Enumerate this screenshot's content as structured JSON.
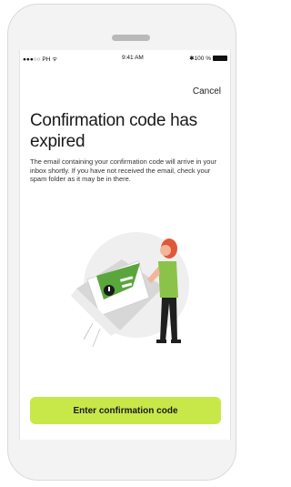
{
  "status_bar": {
    "carrier": "●●●○○ PH ᯤ",
    "time": "9:41 AM",
    "battery": "✱100 %"
  },
  "header": {
    "cancel_label": "Cancel"
  },
  "main": {
    "title": "Confirmation code has expired",
    "body": "The email containing your confirmation code will arrive in your inbox shortly. If you have not received the email, check your spam folder as it may be in there."
  },
  "footer": {
    "cta_label": "Enter confirmation code"
  },
  "colors": {
    "accent": "#c8e84a",
    "envelope_green": "#5aa63c",
    "figure_hair": "#e0583a",
    "figure_shirt": "#8bc34a"
  }
}
